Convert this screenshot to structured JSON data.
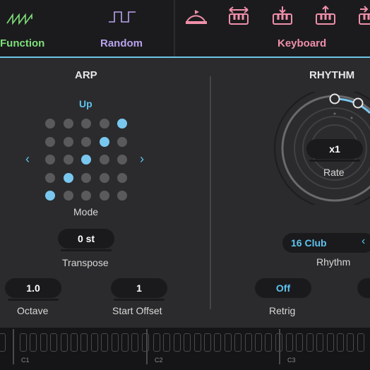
{
  "tabs": {
    "function_label": "Function",
    "random_label": "Random",
    "keyboard_label": "Keyboard"
  },
  "arp": {
    "title": "ARP",
    "direction": "Up",
    "mode_label": "Mode",
    "transpose_value": "0 st",
    "transpose_label": "Transpose",
    "octave_value": "1.0",
    "octave_label": "Octave",
    "start_offset_value": "1",
    "start_offset_label": "Start Offset",
    "pattern": [
      [
        0,
        0,
        0,
        0,
        1
      ],
      [
        0,
        0,
        0,
        1,
        0
      ],
      [
        0,
        0,
        1,
        0,
        0
      ],
      [
        0,
        1,
        0,
        0,
        0
      ],
      [
        1,
        0,
        0,
        0,
        0
      ]
    ]
  },
  "rhythm": {
    "title": "RHYTHM",
    "rate_value": "x1",
    "rate_label": "Rate",
    "rhythm_value": "16 Club",
    "rhythm_label": "Rhythm",
    "retrig_value": "Off",
    "retrig_label": "Retrig"
  },
  "keyboard": {
    "octaves": [
      "C1",
      "C2",
      "C3"
    ]
  },
  "colors": {
    "accent": "#5ec3ee",
    "function": "#7ee07a",
    "random": "#b9a3ee",
    "keyboard": "#f08faa",
    "background": "#2b2b2d"
  },
  "icons": [
    "wave-icon",
    "square-wave-icon",
    "arc-arrow-icon",
    "expand-keys-icon",
    "keys-down-icon",
    "keys-up-icon",
    "keys-right-icon"
  ]
}
